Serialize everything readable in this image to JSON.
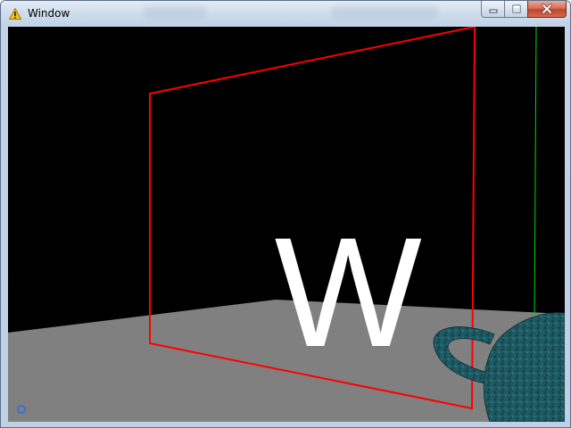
{
  "window": {
    "title": "Window",
    "icon": "warning-icon",
    "buttons": {
      "minimize": "minimize-icon",
      "maximize": "maximize-icon",
      "close": "close-icon"
    }
  },
  "scene": {
    "background_color": "#000000",
    "floor_color": "#808080",
    "frame_color": "#ff0000",
    "axis_color": "#00ff00",
    "text_color": "#ffffff",
    "teapot_color": "#1e5a63",
    "gizmo_color": "#3a6fd8",
    "mirrored_letter": "W"
  }
}
